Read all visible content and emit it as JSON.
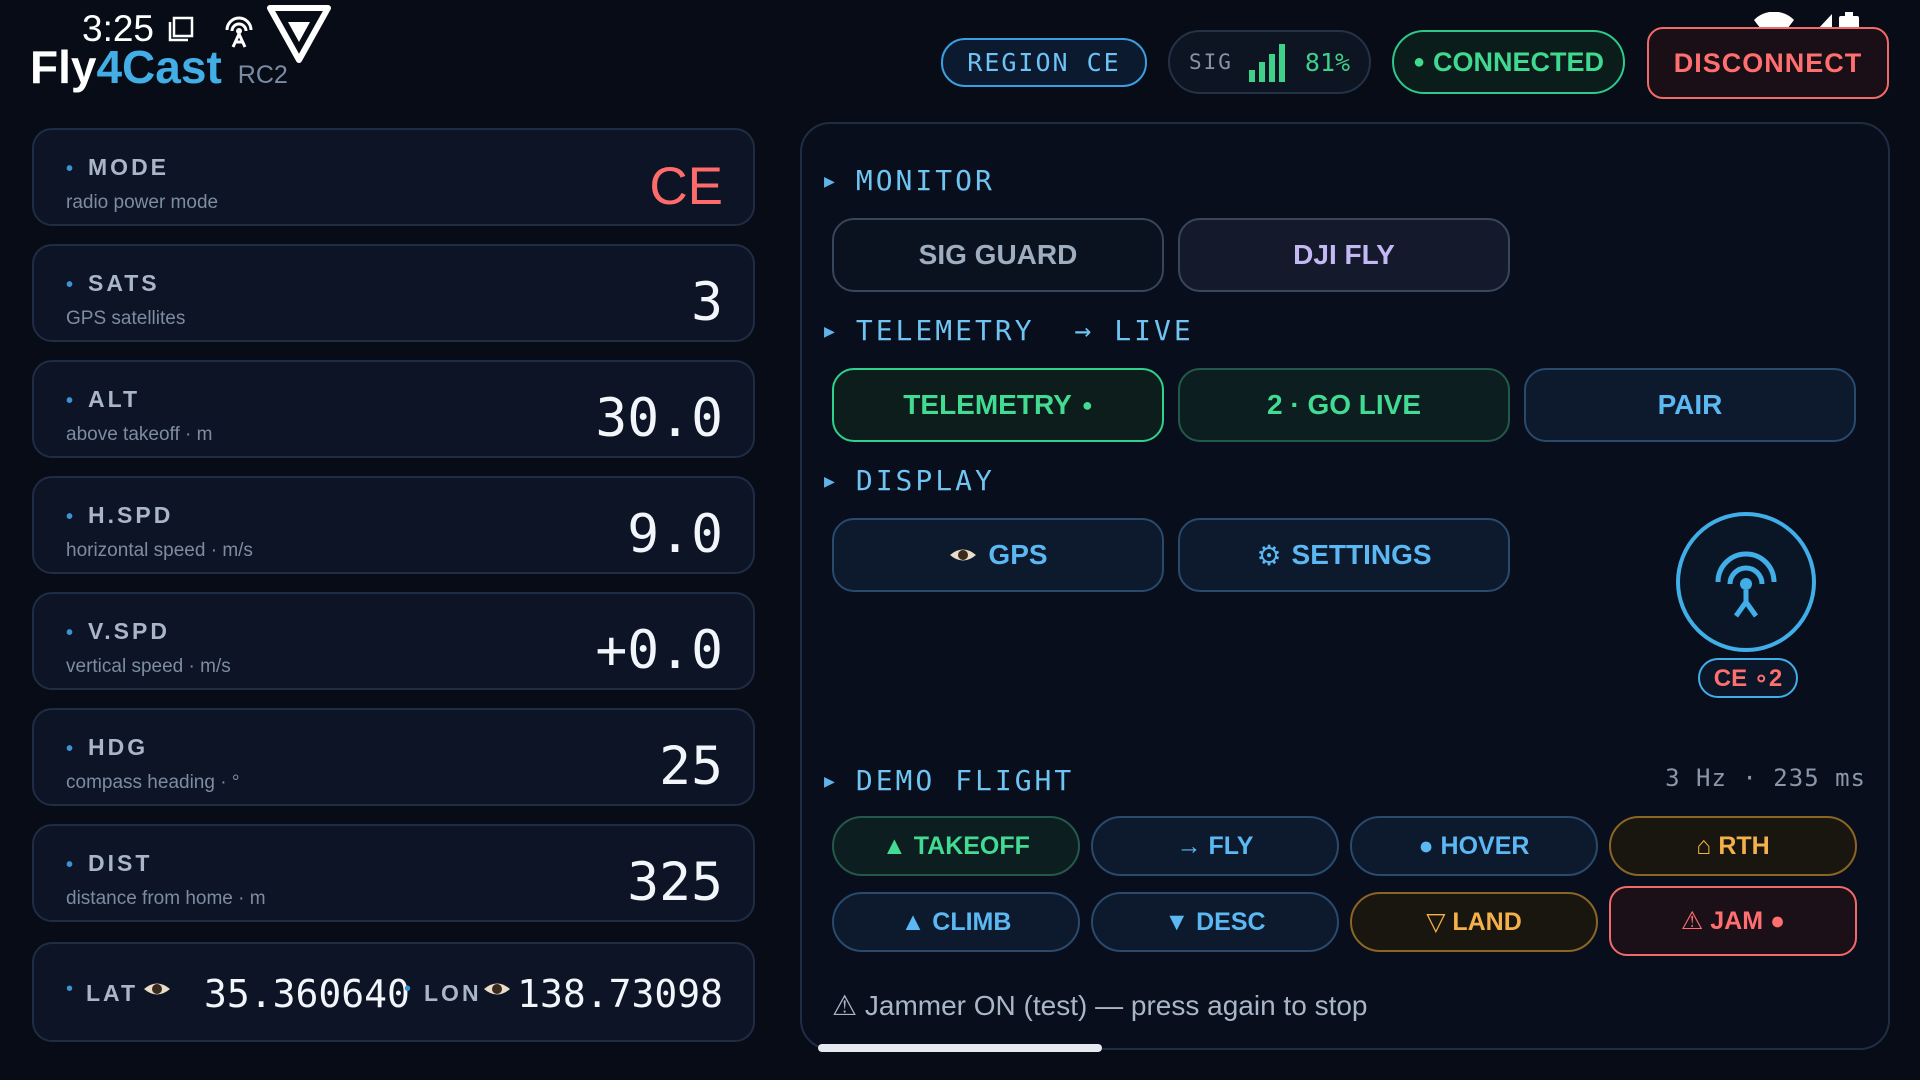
{
  "status_bar": {
    "time": "3:25"
  },
  "brand": {
    "name_part1": "Fly",
    "name_part2": "4Cast",
    "subtitle": "RC2"
  },
  "header": {
    "region": "REGION CE",
    "sig_label": "SIG",
    "sig_value": "81%",
    "connected": "CONNECTED",
    "disconnect": "DISCONNECT"
  },
  "telemetry_cards": [
    {
      "name": "MODE",
      "desc": "radio power mode",
      "value": "CE"
    },
    {
      "name": "SATS",
      "desc": "GPS satellites",
      "value": "3"
    },
    {
      "name": "ALT",
      "desc": "above takeoff · m",
      "value": "30.0"
    },
    {
      "name": "H.SPD",
      "desc": "horizontal speed · m/s",
      "value": "9.0"
    },
    {
      "name": "V.SPD",
      "desc": "vertical speed · m/s",
      "value": "+0.0"
    },
    {
      "name": "HDG",
      "desc": "compass heading · °",
      "value": "25"
    },
    {
      "name": "DIST",
      "desc": "distance from home · m",
      "value": "325"
    }
  ],
  "position": {
    "lat_label": "LAT",
    "lat": "35.360640",
    "lon_label": "LON",
    "lon": "138.73098"
  },
  "panel": {
    "monitor": {
      "title": "MONITOR",
      "sig_guard": "SIG GUARD",
      "dji_fly": "DJI FLY"
    },
    "telemetry": {
      "title": "TELEMETRY",
      "arrow": "→",
      "live": "LIVE",
      "telemetry_btn": "TELEMETRY",
      "go_live": "2 · GO LIVE",
      "pair": "PAIR"
    },
    "display": {
      "title": "DISPLAY",
      "gps": "GPS",
      "settings": "SETTINGS"
    },
    "radar_badge": "CE ∘2",
    "demo": {
      "title": "DEMO FLIGHT",
      "rate": "3 Hz · 235 ms",
      "takeoff": "▲ TAKEOFF",
      "fly": "→ FLY",
      "hover": "● HOVER",
      "rth": "⌂ RTH",
      "climb": "▲ CLIMB",
      "desc": "▼ DESC",
      "land": "▽ LAND",
      "jam": "⚠ JAM ●"
    },
    "jam_status": "⚠ Jammer ON (test) — press again to stop"
  },
  "colors": {
    "accent": "#43aee6",
    "good": "#40d990",
    "danger": "#ff6f6f",
    "warn": "#f4b04a"
  }
}
